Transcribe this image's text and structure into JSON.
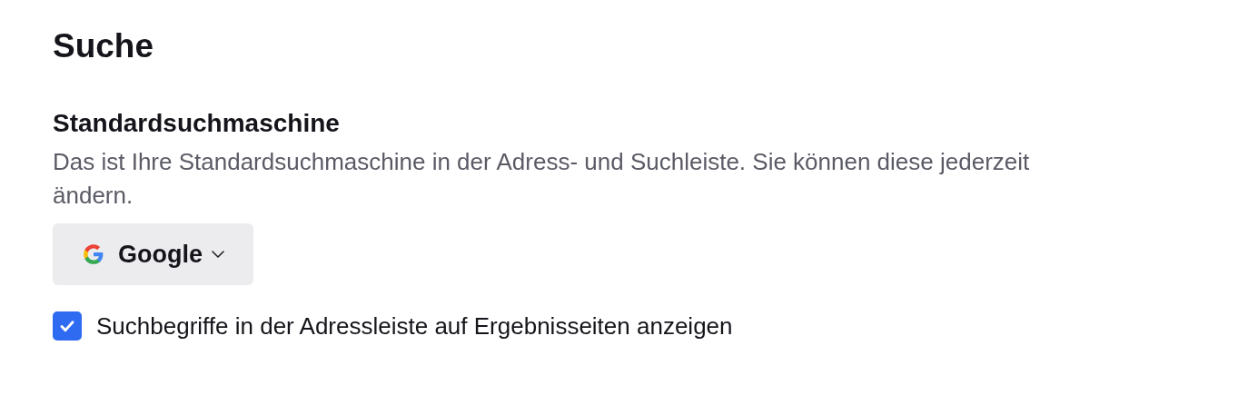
{
  "heading": "Suche",
  "section": {
    "title": "Standardsuchmaschine",
    "description": "Das ist Ihre Standardsuchmaschine in der Adress- und Suchleiste. Sie können diese jederzeit ändern.",
    "engine_dropdown": {
      "label": "Google"
    }
  },
  "checkbox": {
    "label": "Suchbegriffe in der Adressleiste auf Ergebnisseiten anzeigen",
    "checked": true
  }
}
